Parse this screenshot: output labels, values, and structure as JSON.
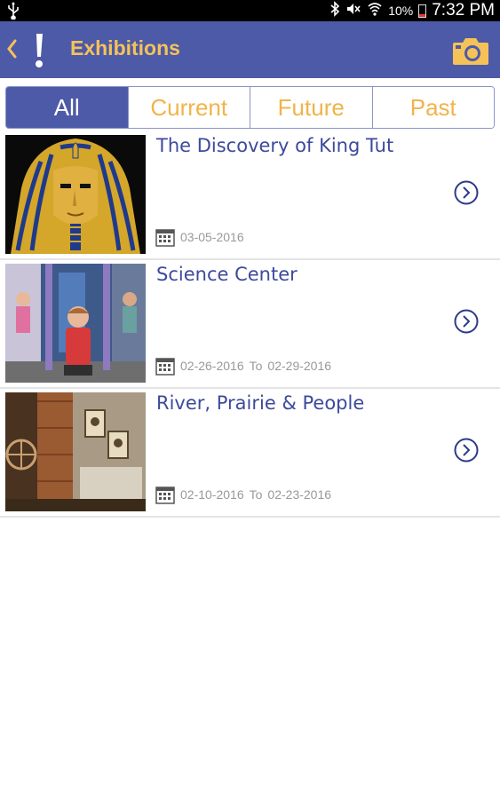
{
  "status_bar": {
    "battery": "10%",
    "time": "7:32 PM"
  },
  "app_bar": {
    "title": "Exhibitions"
  },
  "tabs": [
    {
      "label": "All",
      "active": true
    },
    {
      "label": "Current",
      "active": false
    },
    {
      "label": "Future",
      "active": false
    },
    {
      "label": "Past",
      "active": false
    }
  ],
  "exhibitions": [
    {
      "title": "The Discovery of King Tut",
      "start": "03-05-2016",
      "to": "",
      "end": ""
    },
    {
      "title": "Science Center",
      "start": "02-26-2016",
      "to": "To",
      "end": "02-29-2016"
    },
    {
      "title": "River, Prairie & People",
      "start": "02-10-2016",
      "to": "To",
      "end": "02-23-2016"
    }
  ],
  "colors": {
    "primary": "#4d5aa7",
    "accent": "#f5c25a",
    "title_text": "#3d4a9b",
    "date_text": "#999999"
  }
}
